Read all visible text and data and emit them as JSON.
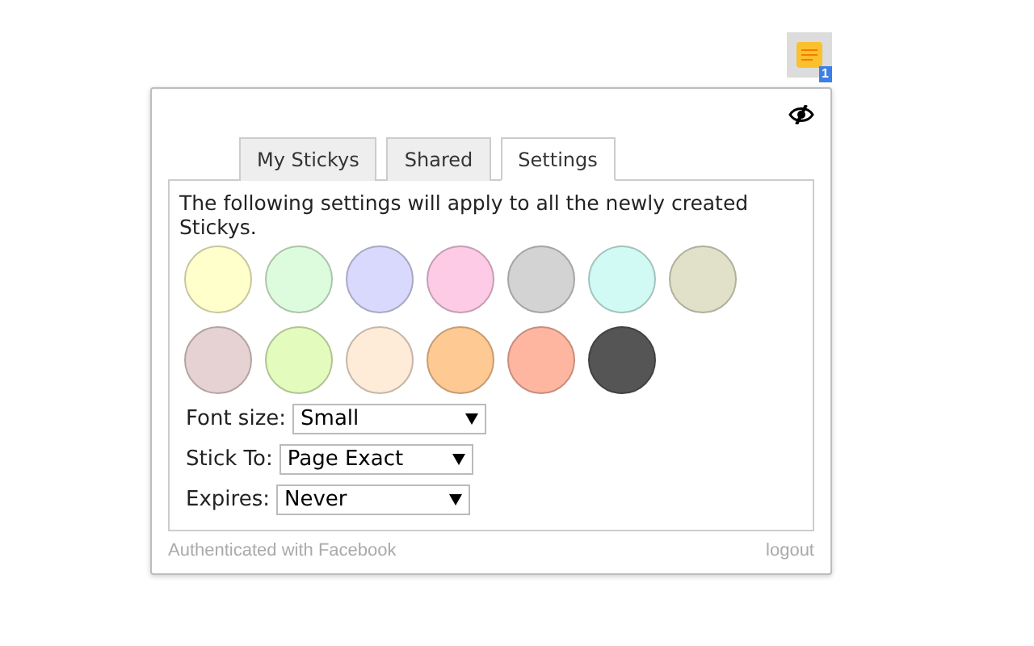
{
  "extension_button": {
    "badge": "1"
  },
  "tabs": [
    {
      "label": "My Stickys",
      "selected": false
    },
    {
      "label": "Shared",
      "selected": false
    },
    {
      "label": "Settings",
      "selected": true
    }
  ],
  "settings": {
    "intro": "The following settings will apply to all the newly created Stickys.",
    "swatches": [
      {
        "color": "#ffffcc"
      },
      {
        "color": "#ddfcdd"
      },
      {
        "color": "#d9d9fe"
      },
      {
        "color": "#fecbe7"
      },
      {
        "color": "#d3d3d3"
      },
      {
        "color": "#d1faf4"
      },
      {
        "color": "#e1e1c9"
      },
      {
        "color": "#e6d2d2"
      },
      {
        "color": "#e3fbbd"
      },
      {
        "color": "#feebd8"
      },
      {
        "color": "#fec992"
      },
      {
        "color": "#feb6a0"
      },
      {
        "color": "#555555"
      }
    ],
    "fields": [
      {
        "label": "Font size:",
        "value": "Small"
      },
      {
        "label": "Stick To:",
        "value": "Page Exact"
      },
      {
        "label": "Expires:",
        "value": "Never"
      }
    ]
  },
  "footer": {
    "status": "Authenticated with Facebook",
    "logout": "logout"
  }
}
